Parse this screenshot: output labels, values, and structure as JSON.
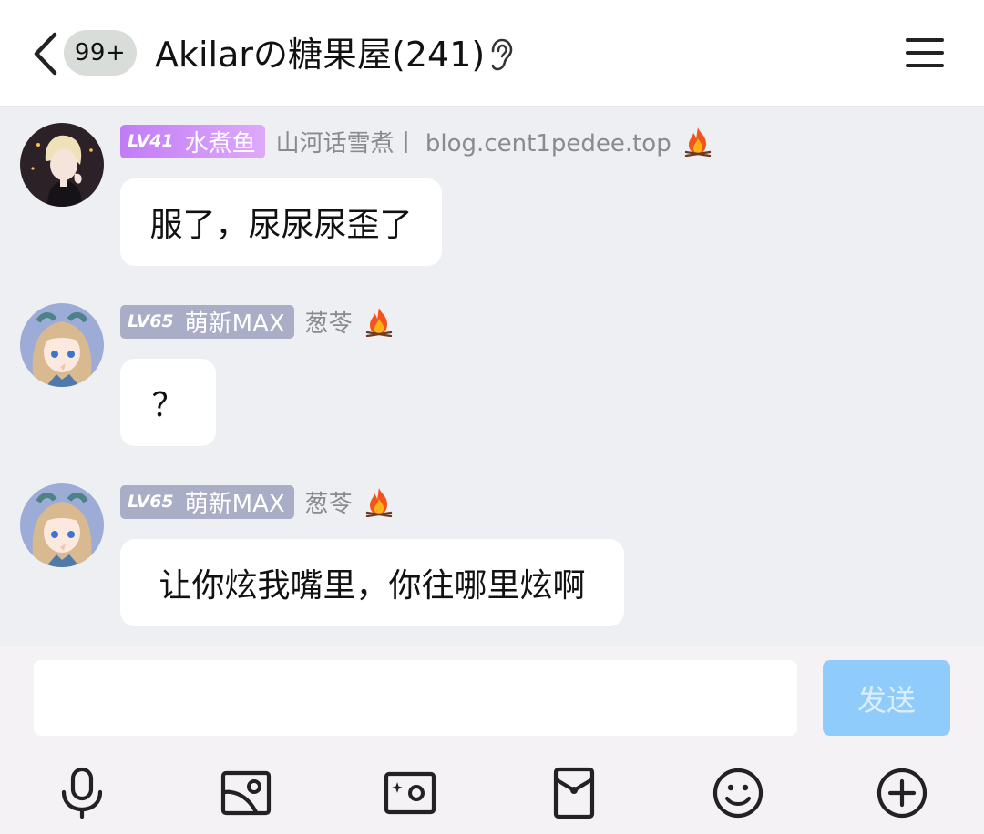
{
  "header": {
    "unread_badge": "99+",
    "title": "Akilarの糖果屋(241)"
  },
  "messages": [
    {
      "level": "LV41",
      "title": "水煮鱼",
      "nickname": "山河话雪煮丨 blog.cent1pedee.top",
      "text": "服了，尿尿尿歪了",
      "tag_color": "#c98af8"
    },
    {
      "level": "LV65",
      "title": "萌新MAX",
      "nickname": "葱苓",
      "text": "？",
      "tag_color": "#a9adc6"
    },
    {
      "level": "LV65",
      "title": "萌新MAX",
      "nickname": "葱苓",
      "text": "让你炫我嘴里，你往哪里炫啊",
      "tag_color": "#a9adc6"
    }
  ],
  "composer": {
    "input_value": "",
    "send_label": "发送",
    "send_color": "#8fcbfb"
  },
  "toolbar": [
    "microphone-icon",
    "image-icon",
    "camera-icon",
    "red-packet-icon",
    "emoji-icon",
    "plus-icon"
  ]
}
